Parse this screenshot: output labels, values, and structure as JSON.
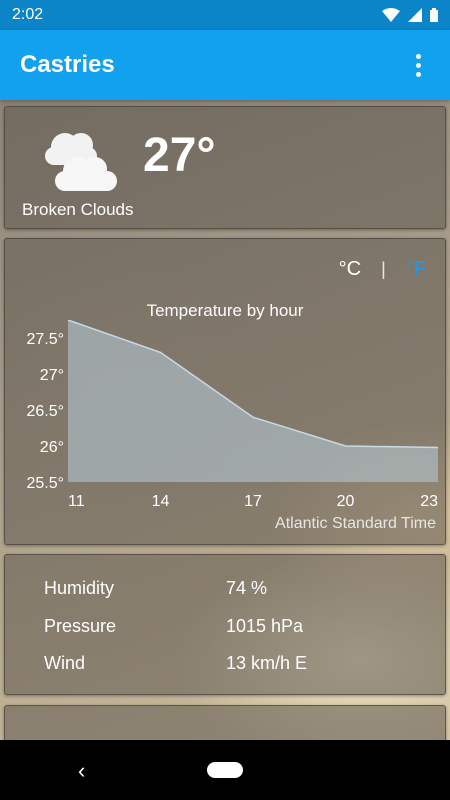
{
  "status_bar": {
    "time": "2:02"
  },
  "app_bar": {
    "title": "Castries"
  },
  "current": {
    "temperature": "27°",
    "condition": "Broken Clouds",
    "icon": "broken-clouds-icon"
  },
  "units": {
    "celsius": "°C",
    "separator": "|",
    "fahrenheit": "°F",
    "selected": "°C"
  },
  "chart_data": {
    "type": "area",
    "title": "Temperature by hour",
    "xlabel": "Atlantic Standard Time",
    "ylabel": "",
    "x": [
      11,
      14,
      17,
      20,
      23
    ],
    "values": [
      27.75,
      27.3,
      26.4,
      26.0,
      25.98
    ],
    "x_ticks": [
      "11",
      "14",
      "17",
      "20",
      "23"
    ],
    "y_ticks": [
      "27.5°",
      "27°",
      "26.5°",
      "26°",
      "25.5°"
    ],
    "ylim": [
      25.5,
      27.75
    ],
    "colors": {
      "fill": "#b8ccd8",
      "stroke": "#c8dae6"
    }
  },
  "details": [
    {
      "label": "Humidity",
      "value": "74 %"
    },
    {
      "label": "Pressure",
      "value": "1015 hPa"
    },
    {
      "label": "Wind",
      "value": "13 km/h E"
    }
  ],
  "colors": {
    "status_bar": "#0c84c8",
    "app_bar": "#12a1ee",
    "accent": "#1a9de6"
  }
}
